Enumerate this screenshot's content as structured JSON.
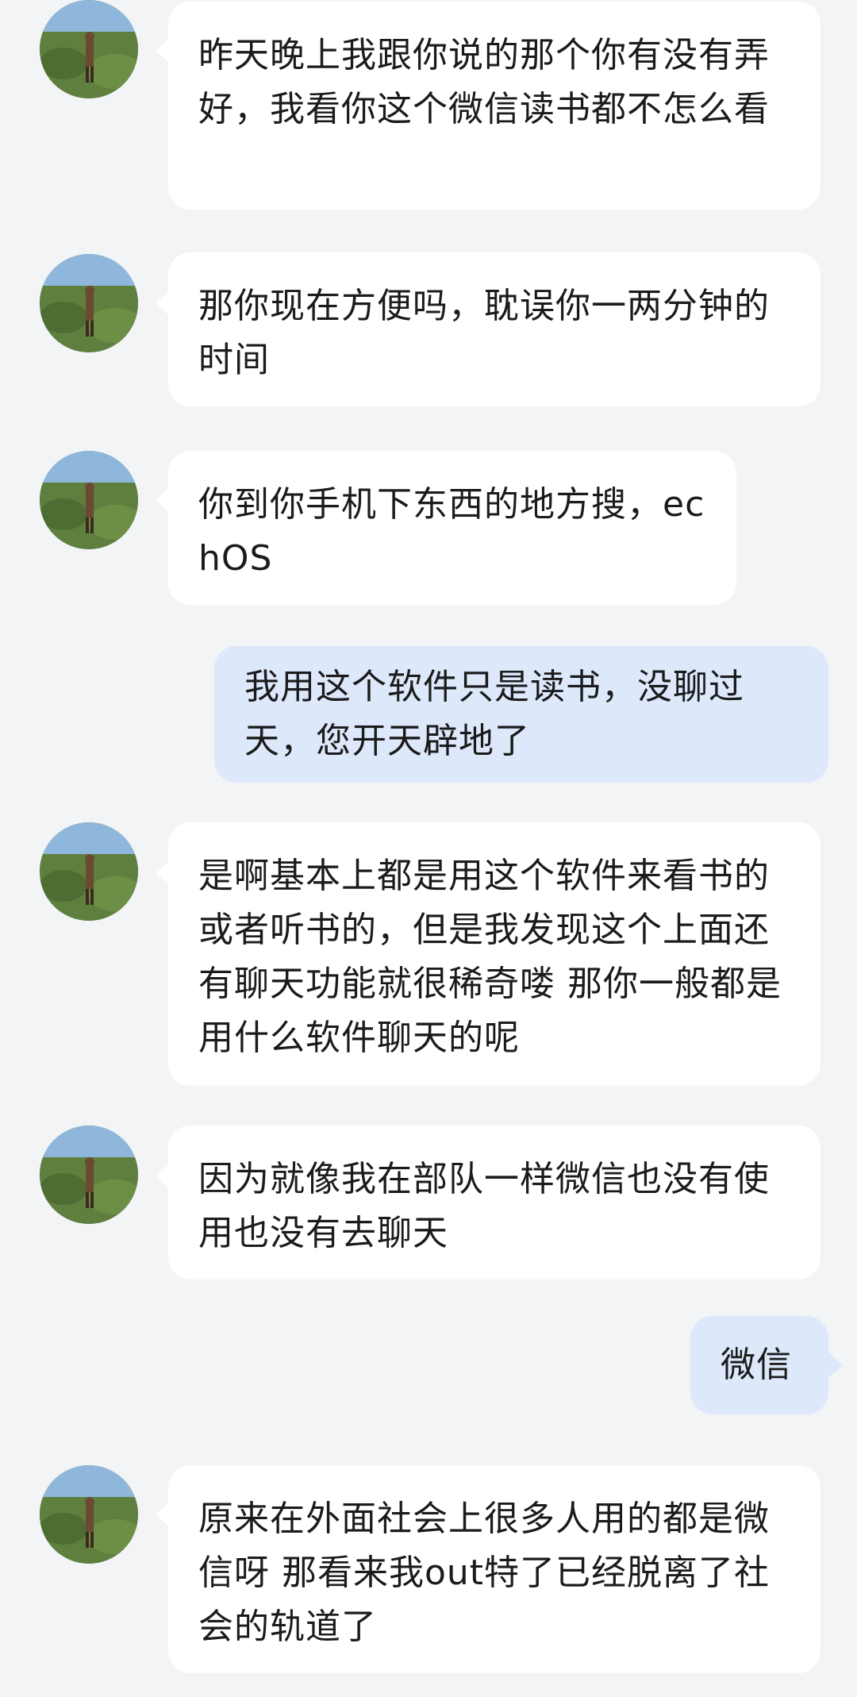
{
  "messages": [
    {
      "sender": "contact",
      "text": "昨天晚上我跟你说的那个你有没有弄好，我看你这个微信读书都不怎么看"
    },
    {
      "sender": "contact",
      "text": "那你现在方便吗，耽误你一两分钟的时间"
    },
    {
      "sender": "contact",
      "text": "你到你手机下东西的地方搜，echOS"
    },
    {
      "sender": "me",
      "text": "我用这个软件只是读书，没聊过天，您开天辟地了"
    },
    {
      "sender": "contact",
      "text": "是啊基本上都是用这个软件来看书的或者听书的，但是我发现这个上面还有聊天功能就很稀奇喽 那你一般都是用什么软件聊天的呢"
    },
    {
      "sender": "contact",
      "text": "因为就像我在部队一样微信也没有使用也没有去聊天"
    },
    {
      "sender": "me",
      "text": "微信"
    },
    {
      "sender": "contact",
      "text": "原来在外面社会上很多人用的都是微信呀 那看来我out特了已经脱离了社会的轨道了"
    }
  ],
  "colors": {
    "background": "#f2f4f6",
    "incoming_bubble": "#ffffff",
    "outgoing_bubble": "#dde8fb",
    "text": "#1b1b1b"
  },
  "icons": {
    "contact_avatar": "avatar-photo-person-standing-in-field"
  }
}
